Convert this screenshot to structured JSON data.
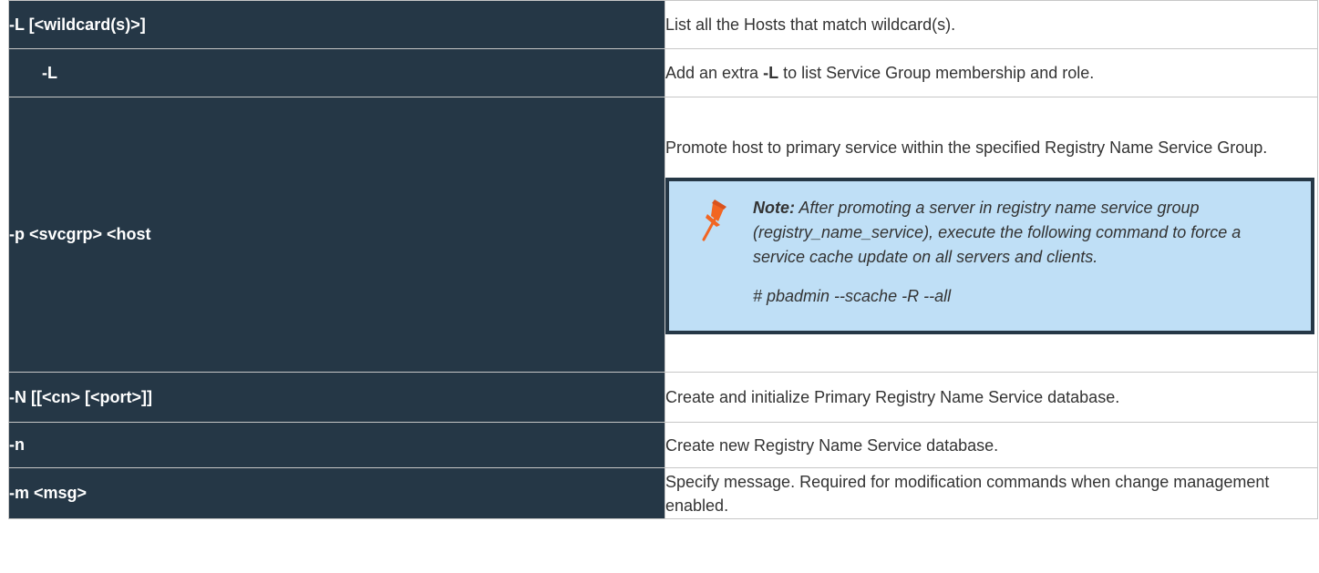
{
  "rows": [
    {
      "option": "-L [<wildcard(s)>]",
      "description": "List all the Hosts that match wildcard(s)."
    },
    {
      "option": "-L",
      "description_pre": "Add an extra ",
      "description_bold": "-L",
      "description_post": " to list Service Group membership and role."
    },
    {
      "option": "-p <svcgrp> <host",
      "description": "Promote host to primary service within the specified Registry Name Service Group.",
      "note": {
        "icon": "pushpin-icon",
        "label": "Note:",
        "text": " After promoting a server in registry name service group (registry_name_service), execute the following command to force a service cache update on all servers and clients.",
        "command": "# pbadmin --scache -R --all"
      }
    },
    {
      "option": "-N [[<cn> [<port>]]",
      "description": "Create and initialize Primary Registry Name Service database."
    },
    {
      "option": "-n",
      "description": "Create new Registry Name Service database."
    },
    {
      "option": "-m <msg>",
      "description": "Specify message. Required for modification commands when change management enabled."
    }
  ],
  "colors": {
    "option_bg": "#253746",
    "note_bg": "#bfdff6",
    "pin": "#f26522"
  }
}
